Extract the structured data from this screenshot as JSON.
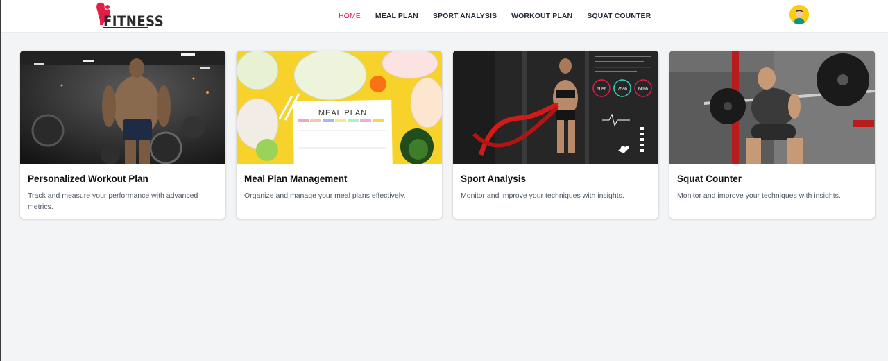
{
  "brand": {
    "name": "FITNESS",
    "accent": "#e11d48"
  },
  "nav": {
    "items": [
      {
        "label": "HOME",
        "active": true
      },
      {
        "label": "MEAL PLAN",
        "active": false
      },
      {
        "label": "SPORT ANALYSIS",
        "active": false
      },
      {
        "label": "WORKOUT PLAN",
        "active": false
      },
      {
        "label": "SQUAT COUNTER",
        "active": false
      }
    ]
  },
  "user": {
    "avatar_icon": "user-avatar-icon"
  },
  "cards": [
    {
      "title": "Personalized Workout Plan",
      "description": "Track and measure your performance with advanced metrics.",
      "image": "bodybuilder-gym-photo"
    },
    {
      "title": "Meal Plan Management",
      "description": "Organize and manage your meal plans effectively.",
      "image": "meal-prep-photo",
      "image_text": "MEAL PLAN"
    },
    {
      "title": "Sport Analysis",
      "description": "Monitor and improve your techniques with insights.",
      "image": "battle-ropes-hud-photo",
      "image_stats": [
        "60%",
        "75%",
        "60%"
      ]
    },
    {
      "title": "Squat Counter",
      "description": "Monitor and improve your techniques with insights.",
      "image": "barbell-squat-photo"
    }
  ]
}
